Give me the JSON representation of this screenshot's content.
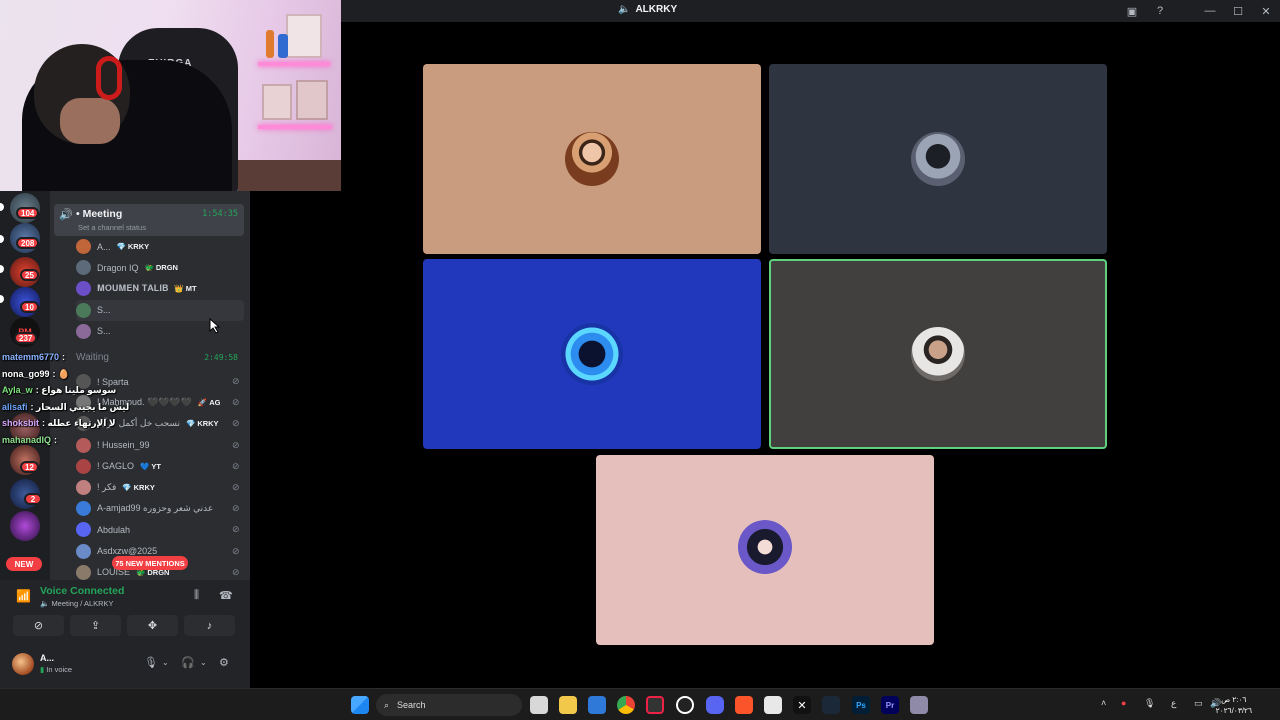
{
  "window": {
    "title": "ALKRKY",
    "controls": [
      "screen-share-icon",
      "help-icon",
      "minimize-icon",
      "maximize-icon",
      "close-icon"
    ]
  },
  "stage": {
    "tiles": [
      {
        "bg": "#c99c80",
        "border": "none"
      },
      {
        "bg": "#2f3540",
        "border": "none"
      },
      {
        "bg": "#2137bc",
        "border": "none"
      },
      {
        "bg": "#423f3f",
        "border": "#5fd17e"
      },
      {
        "bg": "#e5bfbb",
        "border": "none"
      }
    ]
  },
  "server_rail": {
    "badges": [
      "104",
      "208",
      "25",
      "10",
      "237",
      "12",
      "2"
    ],
    "new_label": "NEW"
  },
  "channels": {
    "meeting": {
      "name": "Meeting",
      "time": "1:54:35",
      "status": "Set a channel status"
    },
    "meeting_users": [
      {
        "name": "A...",
        "tag": "KRKY",
        "tag_icon": "💎"
      },
      {
        "name": "Dragon IQ",
        "tag": "DRGN",
        "tag_icon": "🐲"
      },
      {
        "name": "𝐌𝐎𝐔𝐌𝐄𝐍 𝐓𝐀𝐋𝐈𝐁",
        "tag": "MT",
        "tag_icon": "👑"
      },
      {
        "name": "S...",
        "tag": "",
        "tag_icon": ""
      },
      {
        "name": "S...",
        "tag": "",
        "tag_icon": ""
      }
    ],
    "waiting": {
      "name": "Waiting",
      "time": "2:49:58"
    },
    "waiting_users": [
      {
        "name": "! Sparta",
        "tag": "",
        "tag_icon": ""
      },
      {
        "name": "! Mahmoud. 🖤🖤🖤🖤",
        "tag": "AG",
        "tag_icon": "🚀"
      },
      {
        "name": "نسحب خل أكمل قرآية",
        "tag": "KRKY",
        "tag_icon": "💎"
      },
      {
        "name": "! Hussein_99",
        "tag": "",
        "tag_icon": ""
      },
      {
        "name": "! GAGLO",
        "tag": "YT",
        "tag_icon": "💙"
      },
      {
        "name": "! فكر",
        "tag": "KRKY",
        "tag_icon": "💎"
      },
      {
        "name": "A-amjad99 عدني شعر وحزوره",
        "tag": "",
        "tag_icon": ""
      },
      {
        "name": "Abdulah",
        "tag": "",
        "tag_icon": ""
      },
      {
        "name": "Asdxzw@2025",
        "tag": "",
        "tag_icon": ""
      },
      {
        "name": "LOUISE",
        "tag": "DRGN",
        "tag_icon": "🐲"
      }
    ],
    "mentions": "75 NEW MENTIONS"
  },
  "chat": [
    {
      "user": "matemm6770",
      "user_color": "#8ab4ff",
      "msg": ":"
    },
    {
      "user": "nona_go99",
      "user_color": "#ffffff",
      "msg": ": 🥚"
    },
    {
      "user": "Ayla_w",
      "user_color": "#7de27d",
      "msg": ": سوسو ملينا هواع"
    },
    {
      "user": "alisafi",
      "user_color": "#6fa8ff",
      "msg": ": ليش ما يجيني السحار"
    },
    {
      "user": "shoksbit",
      "user_color": "#d7a9ff",
      "msg": ": لا الإرتهاء عطله"
    },
    {
      "user": "mahanadIQ",
      "user_color": "#8ee08e",
      "msg": ":"
    }
  ],
  "voice": {
    "title": "Voice Connected",
    "sub": "Meeting / ALKRKY",
    "buttons": [
      "camera-off-icon",
      "screen-share-icon",
      "activities-icon",
      "soundboard-icon"
    ]
  },
  "user": {
    "name": "A...",
    "status": "In voice"
  },
  "taskbar": {
    "search_label": "Search",
    "clock_time": "٢:٠٦ ص",
    "clock_date": "٢٠٢٦/٠٣/٢٦",
    "lang": "ع"
  }
}
